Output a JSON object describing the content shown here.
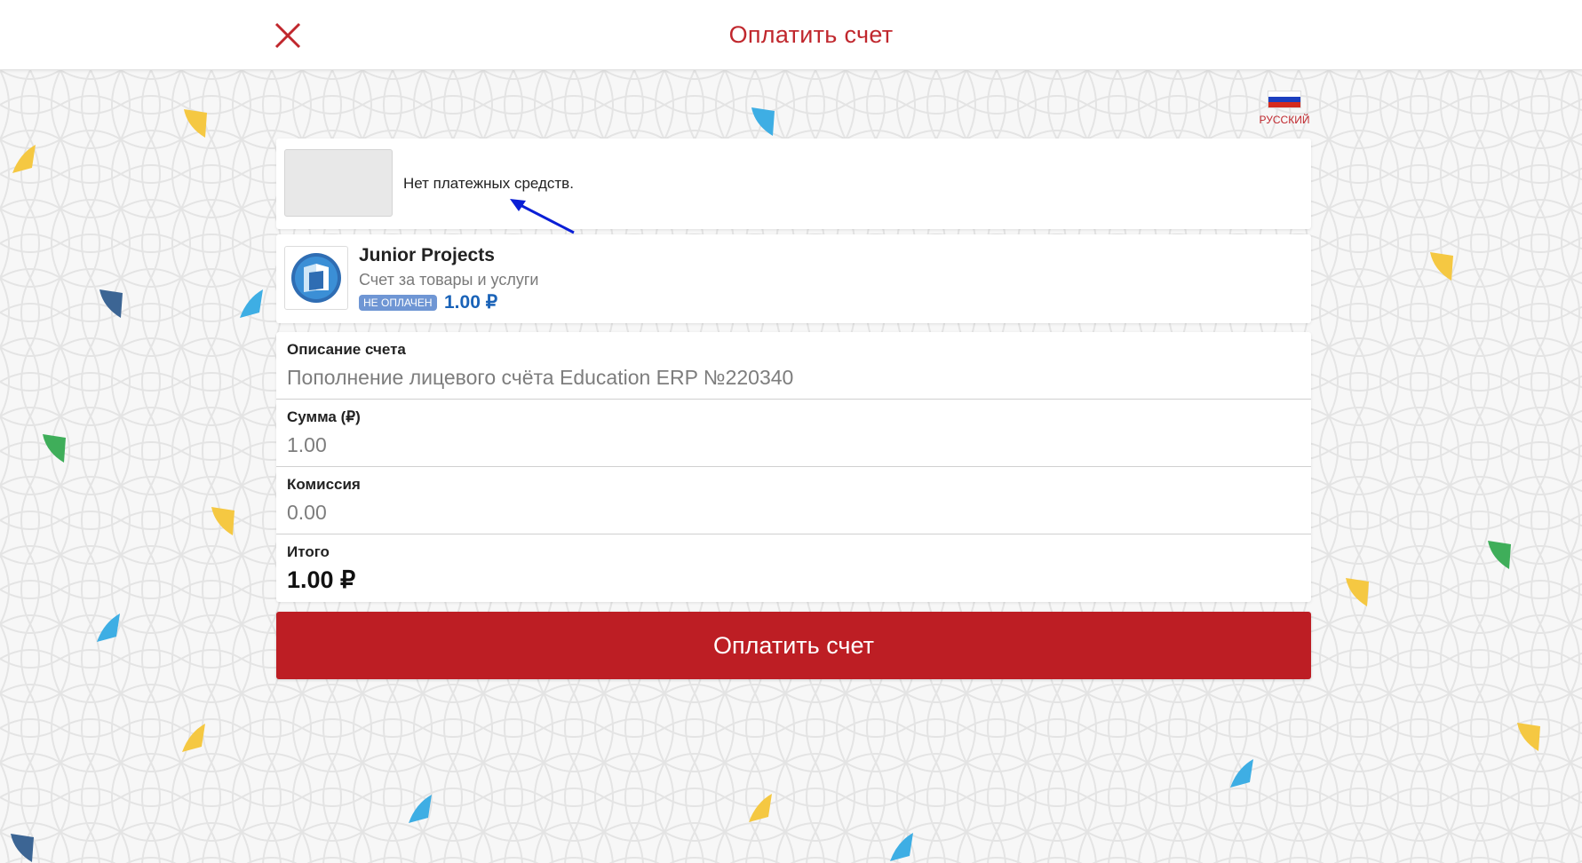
{
  "header": {
    "title": "Оплатить счет",
    "close_icon": "close-x-icon"
  },
  "language": {
    "label": "РУССКИЙ",
    "flag_icon": "russia-flag-icon"
  },
  "payment_methods": {
    "empty_text": "Нет платежных средств."
  },
  "merchant": {
    "name": "Junior Projects",
    "subtitle": "Счет за товары и услуги",
    "status_badge": "НЕ ОПЛАЧЕН",
    "amount": "1.00 ₽",
    "logo_icon": "junior-projects-logo-icon"
  },
  "details": {
    "description_label": "Описание счета",
    "description_value": "Пополнение лицевого счёта Education ERP №220340",
    "sum_label": "Сумма (₽)",
    "sum_value": "1.00",
    "commission_label": "Комиссия",
    "commission_value": "0.00",
    "total_label": "Итого",
    "total_value": "1.00 ₽"
  },
  "pay_button": {
    "label": "Оплатить счет"
  },
  "colors": {
    "brand_red": "#bd1e24",
    "title_red": "#c0272d",
    "amount_blue": "#1a63b8",
    "badge_blue": "#6f96d4"
  }
}
